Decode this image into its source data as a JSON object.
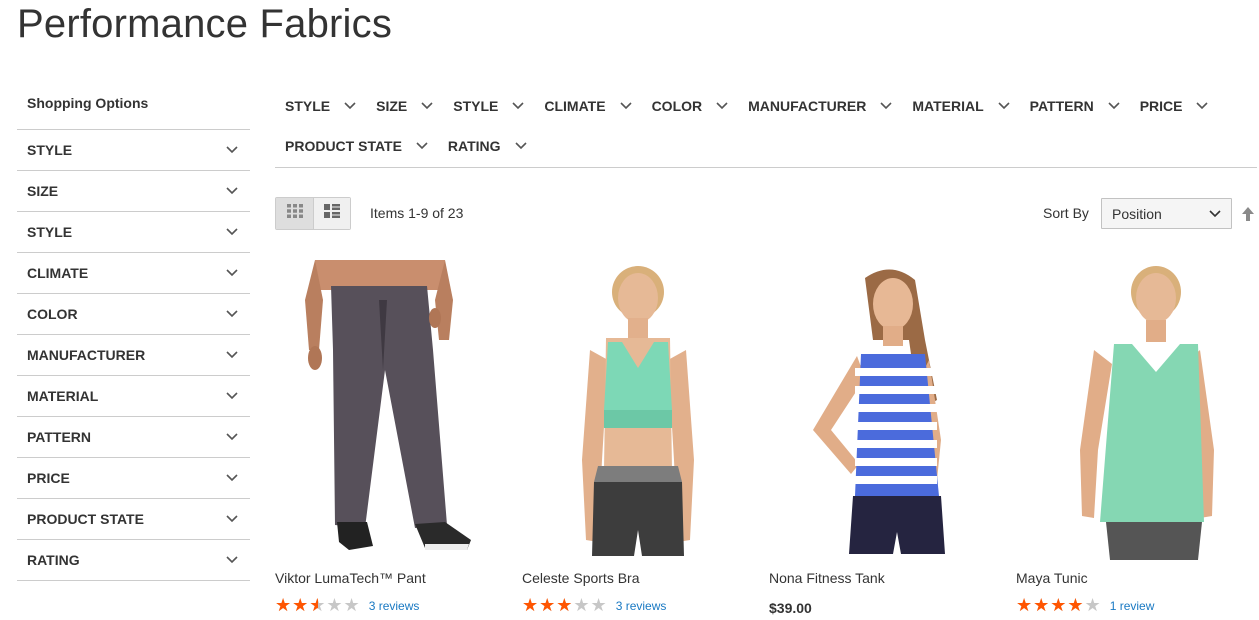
{
  "page_title": "Performance Fabrics",
  "sidebar": {
    "title": "Shopping Options",
    "items": [
      {
        "label": "STYLE"
      },
      {
        "label": "SIZE"
      },
      {
        "label": "STYLE"
      },
      {
        "label": "CLIMATE"
      },
      {
        "label": "COLOR"
      },
      {
        "label": "MANUFACTURER"
      },
      {
        "label": "MATERIAL"
      },
      {
        "label": "PATTERN"
      },
      {
        "label": "PRICE"
      },
      {
        "label": "PRODUCT STATE"
      },
      {
        "label": "RATING"
      }
    ]
  },
  "top_filters": {
    "row1": [
      "STYLE",
      "SIZE",
      "STYLE",
      "CLIMATE",
      "COLOR",
      "MANUFACTURER",
      "MATERIAL",
      "PATTERN",
      "PRICE"
    ],
    "row2": [
      "PRODUCT STATE",
      "RATING"
    ]
  },
  "toolbar": {
    "amount": "Items 1-9 of 23",
    "sort_label": "Sort By",
    "sort_value": "Position",
    "mode_grid_icon": "grid-icon",
    "mode_list_icon": "list-icon"
  },
  "products": [
    {
      "name": "Viktor LumaTech™ Pant",
      "rating_pct": 50,
      "reviews": "3 reviews",
      "price": ""
    },
    {
      "name": "Celeste Sports Bra",
      "rating_pct": 60,
      "reviews": "3 reviews",
      "price": ""
    },
    {
      "name": "Nona Fitness Tank",
      "rating_pct": null,
      "reviews": "",
      "price": "$39.00"
    },
    {
      "name": "Maya Tunic",
      "rating_pct": 80,
      "reviews": "1 review",
      "price": ""
    }
  ],
  "colors": {
    "star_on": "#ff5501",
    "star_off": "#c7c7c7",
    "link": "#1979c3"
  }
}
